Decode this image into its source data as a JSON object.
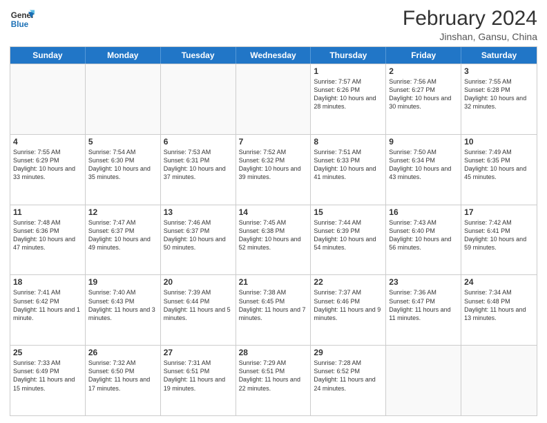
{
  "header": {
    "logo_line1": "General",
    "logo_line2": "Blue",
    "month_year": "February 2024",
    "location": "Jinshan, Gansu, China"
  },
  "days_of_week": [
    "Sunday",
    "Monday",
    "Tuesday",
    "Wednesday",
    "Thursday",
    "Friday",
    "Saturday"
  ],
  "weeks": [
    [
      {
        "day": "",
        "info": ""
      },
      {
        "day": "",
        "info": ""
      },
      {
        "day": "",
        "info": ""
      },
      {
        "day": "",
        "info": ""
      },
      {
        "day": "1",
        "info": "Sunrise: 7:57 AM\nSunset: 6:26 PM\nDaylight: 10 hours and 28 minutes."
      },
      {
        "day": "2",
        "info": "Sunrise: 7:56 AM\nSunset: 6:27 PM\nDaylight: 10 hours and 30 minutes."
      },
      {
        "day": "3",
        "info": "Sunrise: 7:55 AM\nSunset: 6:28 PM\nDaylight: 10 hours and 32 minutes."
      }
    ],
    [
      {
        "day": "4",
        "info": "Sunrise: 7:55 AM\nSunset: 6:29 PM\nDaylight: 10 hours and 33 minutes."
      },
      {
        "day": "5",
        "info": "Sunrise: 7:54 AM\nSunset: 6:30 PM\nDaylight: 10 hours and 35 minutes."
      },
      {
        "day": "6",
        "info": "Sunrise: 7:53 AM\nSunset: 6:31 PM\nDaylight: 10 hours and 37 minutes."
      },
      {
        "day": "7",
        "info": "Sunrise: 7:52 AM\nSunset: 6:32 PM\nDaylight: 10 hours and 39 minutes."
      },
      {
        "day": "8",
        "info": "Sunrise: 7:51 AM\nSunset: 6:33 PM\nDaylight: 10 hours and 41 minutes."
      },
      {
        "day": "9",
        "info": "Sunrise: 7:50 AM\nSunset: 6:34 PM\nDaylight: 10 hours and 43 minutes."
      },
      {
        "day": "10",
        "info": "Sunrise: 7:49 AM\nSunset: 6:35 PM\nDaylight: 10 hours and 45 minutes."
      }
    ],
    [
      {
        "day": "11",
        "info": "Sunrise: 7:48 AM\nSunset: 6:36 PM\nDaylight: 10 hours and 47 minutes."
      },
      {
        "day": "12",
        "info": "Sunrise: 7:47 AM\nSunset: 6:37 PM\nDaylight: 10 hours and 49 minutes."
      },
      {
        "day": "13",
        "info": "Sunrise: 7:46 AM\nSunset: 6:37 PM\nDaylight: 10 hours and 50 minutes."
      },
      {
        "day": "14",
        "info": "Sunrise: 7:45 AM\nSunset: 6:38 PM\nDaylight: 10 hours and 52 minutes."
      },
      {
        "day": "15",
        "info": "Sunrise: 7:44 AM\nSunset: 6:39 PM\nDaylight: 10 hours and 54 minutes."
      },
      {
        "day": "16",
        "info": "Sunrise: 7:43 AM\nSunset: 6:40 PM\nDaylight: 10 hours and 56 minutes."
      },
      {
        "day": "17",
        "info": "Sunrise: 7:42 AM\nSunset: 6:41 PM\nDaylight: 10 hours and 59 minutes."
      }
    ],
    [
      {
        "day": "18",
        "info": "Sunrise: 7:41 AM\nSunset: 6:42 PM\nDaylight: 11 hours and 1 minute."
      },
      {
        "day": "19",
        "info": "Sunrise: 7:40 AM\nSunset: 6:43 PM\nDaylight: 11 hours and 3 minutes."
      },
      {
        "day": "20",
        "info": "Sunrise: 7:39 AM\nSunset: 6:44 PM\nDaylight: 11 hours and 5 minutes."
      },
      {
        "day": "21",
        "info": "Sunrise: 7:38 AM\nSunset: 6:45 PM\nDaylight: 11 hours and 7 minutes."
      },
      {
        "day": "22",
        "info": "Sunrise: 7:37 AM\nSunset: 6:46 PM\nDaylight: 11 hours and 9 minutes."
      },
      {
        "day": "23",
        "info": "Sunrise: 7:36 AM\nSunset: 6:47 PM\nDaylight: 11 hours and 11 minutes."
      },
      {
        "day": "24",
        "info": "Sunrise: 7:34 AM\nSunset: 6:48 PM\nDaylight: 11 hours and 13 minutes."
      }
    ],
    [
      {
        "day": "25",
        "info": "Sunrise: 7:33 AM\nSunset: 6:49 PM\nDaylight: 11 hours and 15 minutes."
      },
      {
        "day": "26",
        "info": "Sunrise: 7:32 AM\nSunset: 6:50 PM\nDaylight: 11 hours and 17 minutes."
      },
      {
        "day": "27",
        "info": "Sunrise: 7:31 AM\nSunset: 6:51 PM\nDaylight: 11 hours and 19 minutes."
      },
      {
        "day": "28",
        "info": "Sunrise: 7:29 AM\nSunset: 6:51 PM\nDaylight: 11 hours and 22 minutes."
      },
      {
        "day": "29",
        "info": "Sunrise: 7:28 AM\nSunset: 6:52 PM\nDaylight: 11 hours and 24 minutes."
      },
      {
        "day": "",
        "info": ""
      },
      {
        "day": "",
        "info": ""
      }
    ]
  ]
}
